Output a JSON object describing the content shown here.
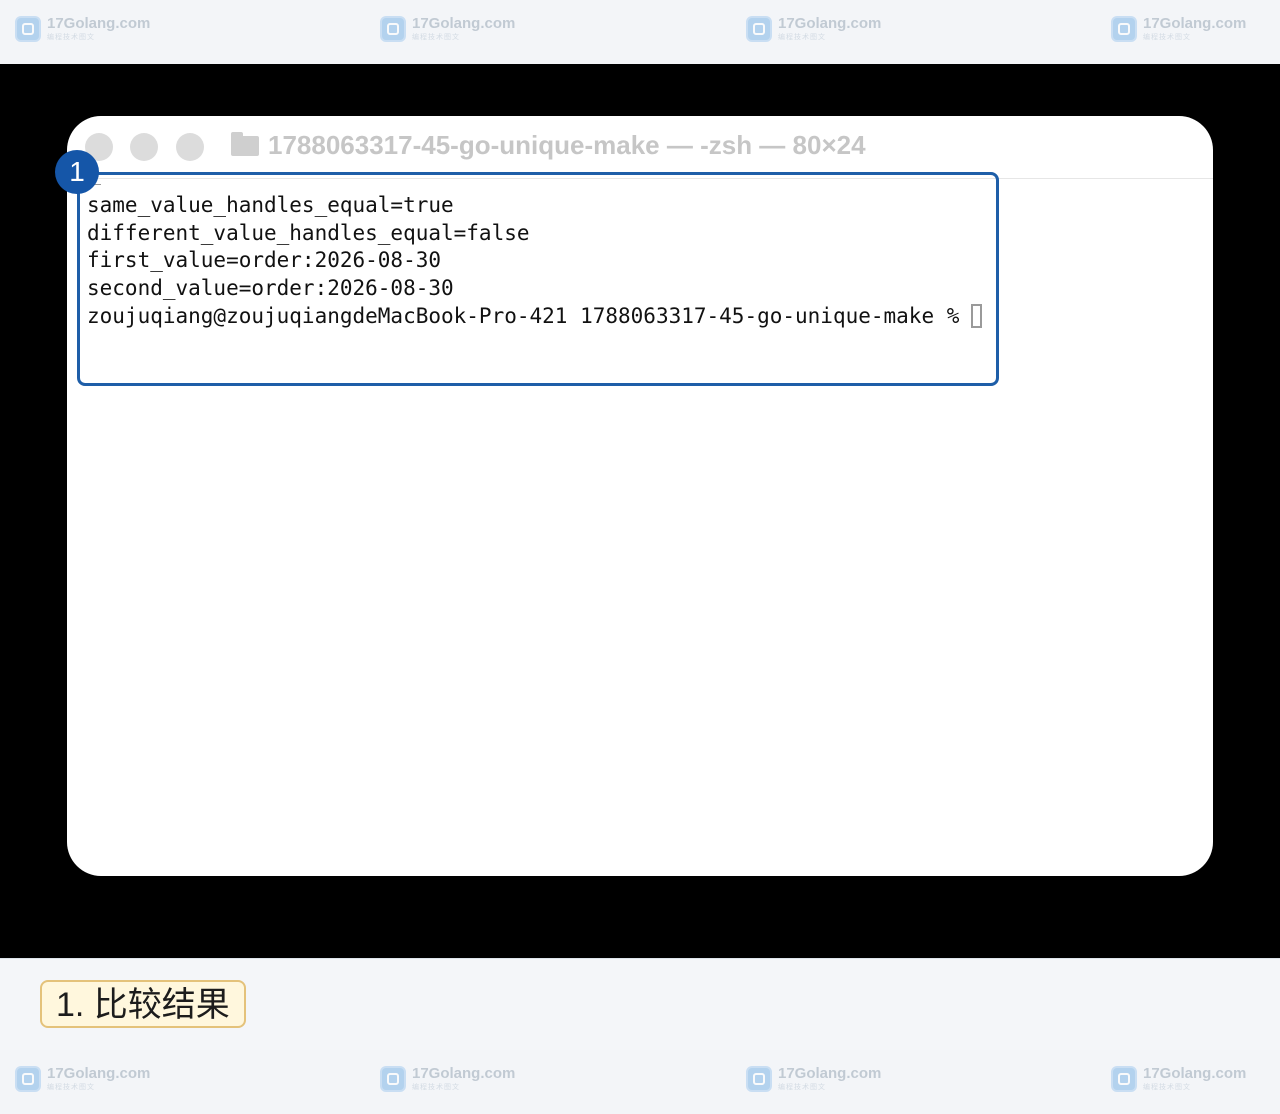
{
  "watermark": {
    "text": "17Golang.com",
    "subtext": "编程技术图文"
  },
  "window": {
    "title": "1788063317-45-go-unique-make — -zsh — 80×24"
  },
  "terminal": {
    "lines": [
      "same_value_handles_equal=true",
      "different_value_handles_equal=false",
      "first_value=order:2026-08-30",
      "second_value=order:2026-08-30"
    ],
    "prompt": "zoujuqiang@zoujuqiangdeMacBook-Pro-421 1788063317-45-go-unique-make %"
  },
  "annotation": {
    "badge": "1",
    "caption": "1. 比较结果"
  },
  "colors": {
    "highlight": "#1e5ea8",
    "badge": "#1556a8",
    "caption_border": "#e4c27a"
  }
}
